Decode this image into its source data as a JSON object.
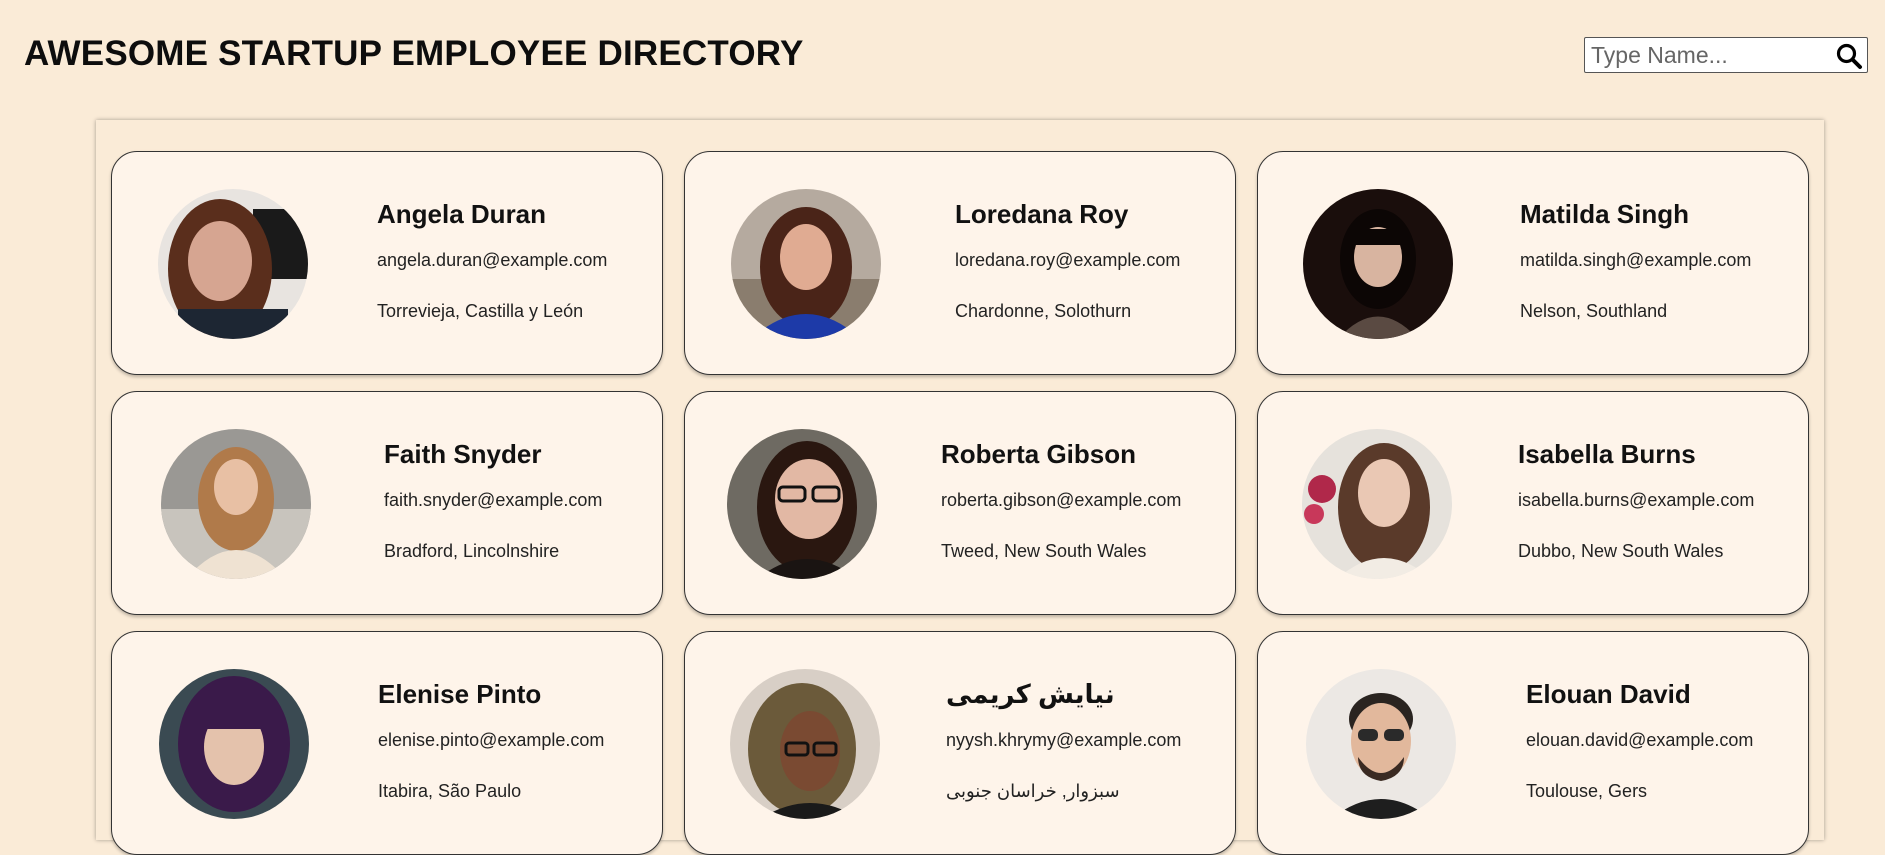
{
  "header": {
    "title": "AWESOME STARTUP EMPLOYEE DIRECTORY",
    "search_placeholder": "Type Name..."
  },
  "icons": {
    "search": "search-icon"
  },
  "colors": {
    "background": "#faebd7",
    "card": "#fef4ea",
    "card_border": "#333333"
  },
  "employees": [
    {
      "name": "Angela Duran",
      "email": "angela.duran@example.com",
      "location": "Torrevieja, Castilla y León"
    },
    {
      "name": "Loredana Roy",
      "email": "loredana.roy@example.com",
      "location": "Chardonne, Solothurn"
    },
    {
      "name": "Matilda Singh",
      "email": "matilda.singh@example.com",
      "location": "Nelson, Southland"
    },
    {
      "name": "Faith Snyder",
      "email": "faith.snyder@example.com",
      "location": "Bradford, Lincolnshire"
    },
    {
      "name": "Roberta Gibson",
      "email": "roberta.gibson@example.com",
      "location": "Tweed, New South Wales"
    },
    {
      "name": "Isabella Burns",
      "email": "isabella.burns@example.com",
      "location": "Dubbo, New South Wales"
    },
    {
      "name": "Elenise Pinto",
      "email": "elenise.pinto@example.com",
      "location": "Itabira, São Paulo"
    },
    {
      "name": "نیایش کریمی",
      "email": "nyysh.khrymy@example.com",
      "location": "سبزوار, خراسان جنوبی"
    },
    {
      "name": "Elouan David",
      "email": "elouan.david@example.com",
      "location": "Toulouse, Gers"
    }
  ]
}
